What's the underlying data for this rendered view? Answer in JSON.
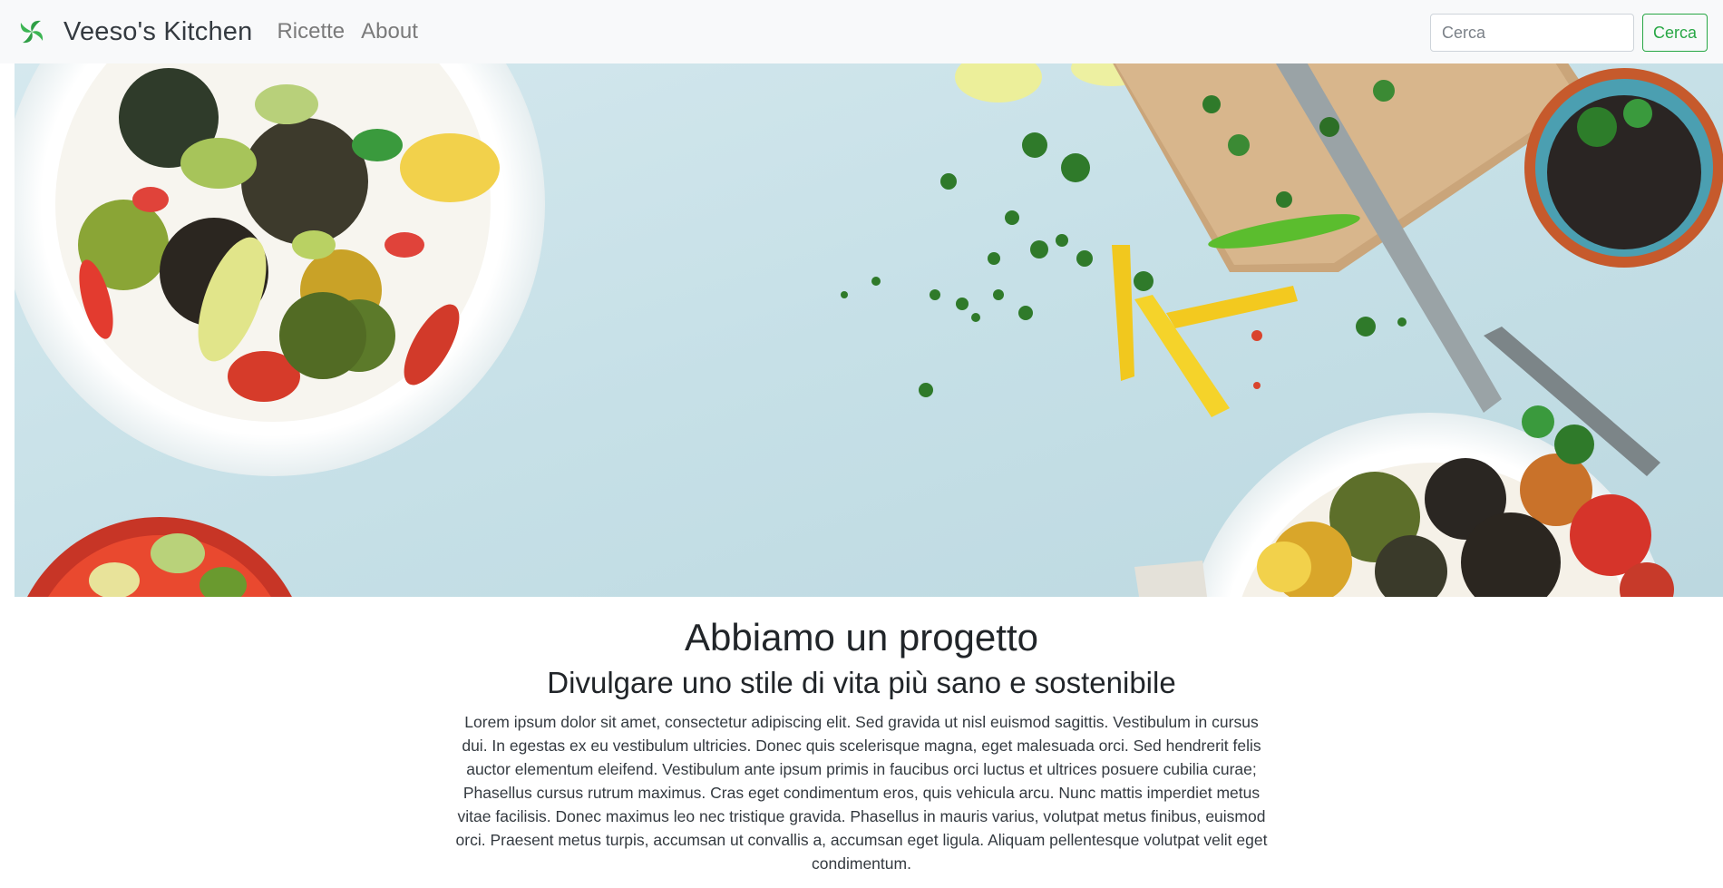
{
  "navbar": {
    "brand_name": "Veeso's Kitchen",
    "brand_icon": "green-leaf-spiral-icon",
    "links": [
      {
        "label": "Ricette"
      },
      {
        "label": "About"
      }
    ],
    "search": {
      "placeholder": "Cerca",
      "value": "",
      "button_label": "Cerca"
    },
    "accent_color": "#28a745"
  },
  "hero": {
    "image": "food-flatlay-hero-image"
  },
  "content": {
    "title": "Abbiamo un progetto",
    "subtitle": "Divulgare uno stile di vita più sano e sostenibile",
    "body": "Lorem ipsum dolor sit amet, consectetur adipiscing elit. Sed gravida ut nisl euismod sagittis. Vestibulum in cursus dui. In egestas ex eu vestibulum ultricies. Donec quis scelerisque magna, eget malesuada orci. Sed hendrerit felis auctor elementum eleifend. Vestibulum ante ipsum primis in faucibus orci luctus et ultrices posuere cubilia curae; Phasellus cursus rutrum maximus. Cras eget condimentum eros, quis vehicula arcu. Nunc mattis imperdiet metus vitae facilisis. Donec maximus leo nec tristique gravida. Phasellus in mauris varius, volutpat metus finibus, euismod orci. Praesent metus turpis, accumsan ut convallis a, accumsan eget ligula. Aliquam pellentesque volutpat velit eget condimentum."
  }
}
